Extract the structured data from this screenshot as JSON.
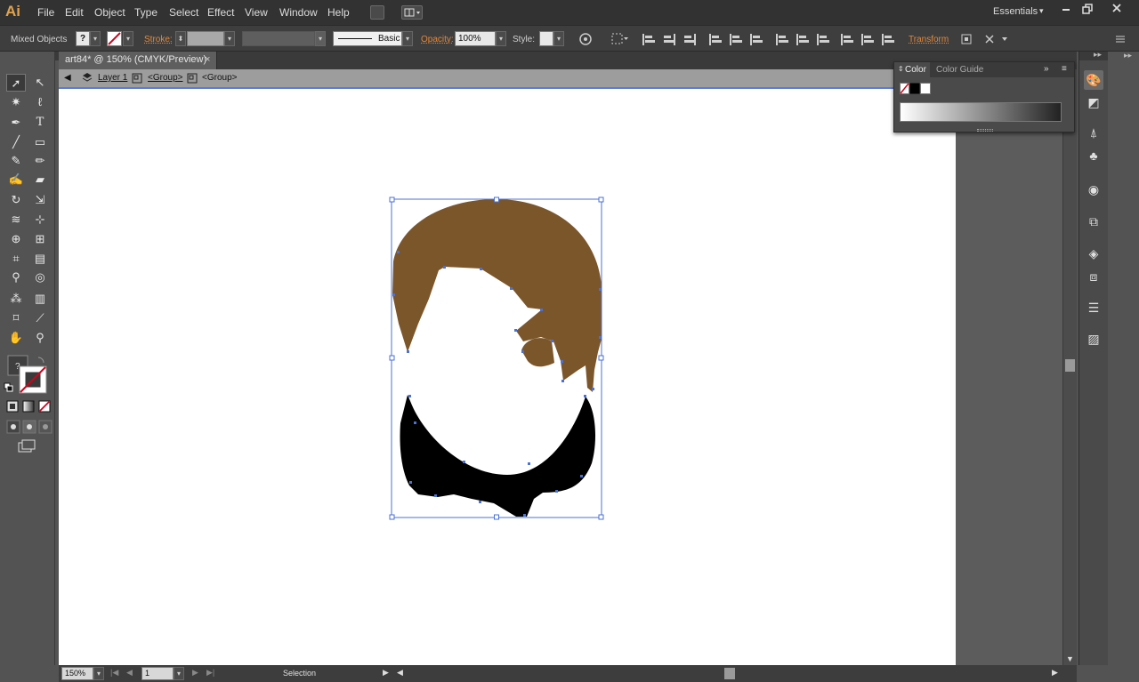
{
  "app": {
    "logo": "Ai"
  },
  "menu": [
    "File",
    "Edit",
    "Object",
    "Type",
    "Select",
    "Effect",
    "View",
    "Window",
    "Help"
  ],
  "workspace": "Essentials",
  "control_bar": {
    "selection_type": "Mixed Objects",
    "fill_value": "?",
    "stroke_label": "Stroke:",
    "brush_value": "Basic",
    "opacity_label": "Opacity:",
    "opacity_value": "100%",
    "style_label": "Style:",
    "transform_label": "Transform"
  },
  "document": {
    "tab_title": "art84* @ 150% (CMYK/Preview)",
    "close_glyph": "×"
  },
  "breadcrumb": [
    "Layer 1",
    "<Group>",
    "<Group>"
  ],
  "status": {
    "zoom": "150%",
    "artboard_number": "1",
    "tool_name": "Selection"
  },
  "color_panel": {
    "tabs": [
      "Color",
      "Color Guide"
    ]
  },
  "colors": {
    "hair": "#7b562b",
    "body": "#000000",
    "selection": "#4a72d6",
    "accent": "#e1883b"
  },
  "icons": {
    "tools": [
      "selection-tool-icon",
      "direct-selection-tool-icon",
      "magic-wand-icon",
      "lasso-icon",
      "pen-tool-icon",
      "type-tool-icon",
      "line-tool-icon",
      "rectangle-tool-icon",
      "paintbrush-icon",
      "pencil-icon",
      "blob-brush-icon",
      "eraser-icon",
      "rotate-icon",
      "scale-icon",
      "width-tool-icon",
      "free-transform-icon",
      "shape-builder-icon",
      "perspective-grid-icon",
      "mesh-tool-icon",
      "gradient-tool-icon",
      "eyedropper-icon",
      "blend-tool-icon",
      "symbol-sprayer-icon",
      "column-graph-icon",
      "artboard-tool-icon",
      "slice-tool-icon",
      "hand-tool-icon",
      "zoom-tool-icon"
    ]
  }
}
